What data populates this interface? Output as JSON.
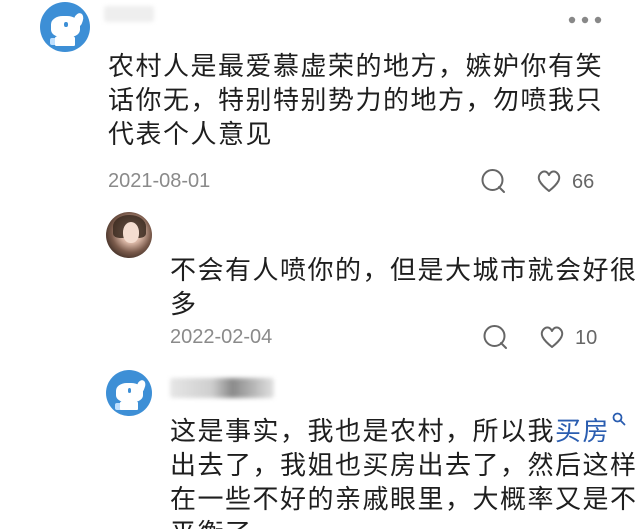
{
  "comments": [
    {
      "text": "农村人是最爱慕虚荣的地方，嫉妒你有笑话你无，特别特别势力的地方，勿喷我只代表个人意见",
      "line1": "农村人是最爱慕虚荣的地方，嫉妒你有笑",
      "line2": "话你无，特别特别势力的地方，勿喷我只",
      "line3": "代表个人意见",
      "date": "2021-08-01",
      "likes": "66",
      "avatar": "dog-avatar"
    },
    {
      "line1": "不会有人喷你的，但是大城市就会好很",
      "line2": "多",
      "date": "2022-02-04",
      "likes": "10",
      "avatar": "girl-avatar"
    },
    {
      "line1_a": "这是事实，我也是农村，所以我",
      "line1_link": "买房",
      "line2": "出去了，我姐也买房出去了，然后这样",
      "line3": "在一些不好的亲戚眼里，大概率又是不",
      "line4": "平衡了",
      "avatar": "dog-avatar"
    }
  ],
  "icons": {
    "reply": "comment-bubble-icon",
    "like": "heart-icon",
    "more": "more-dots-icon",
    "search": "search-icon"
  },
  "colors": {
    "text": "#1e1e1e",
    "meta": "#8a8a8a",
    "link": "#2a5db0",
    "avatar_bg": "#3d8fd6"
  }
}
